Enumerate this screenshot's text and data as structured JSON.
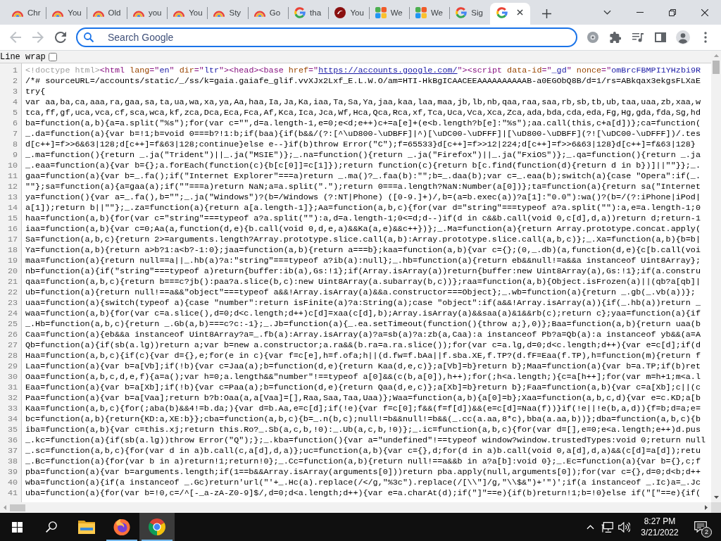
{
  "tabs": [
    {
      "title": "Chr",
      "kind": "arc",
      "selected": false
    },
    {
      "title": "You",
      "kind": "arc",
      "selected": false
    },
    {
      "title": "Old",
      "kind": "arc",
      "selected": false
    },
    {
      "title": "you",
      "kind": "arc",
      "selected": false
    },
    {
      "title": "You",
      "kind": "arc",
      "selected": false
    },
    {
      "title": "Sty",
      "kind": "arc",
      "selected": false
    },
    {
      "title": "Go",
      "kind": "arc",
      "selected": false
    },
    {
      "title": "tha",
      "kind": "google",
      "selected": false
    },
    {
      "title": "You",
      "kind": "disc",
      "selected": false
    },
    {
      "title": "We",
      "kind": "tiles",
      "selected": false
    },
    {
      "title": "We",
      "kind": "tiles",
      "selected": false
    },
    {
      "title": "Sig",
      "kind": "google",
      "selected": false
    },
    {
      "kind": "google",
      "selected": true
    }
  ],
  "toolbar": {
    "nav": [
      {
        "kind": "back",
        "disabled": true
      },
      {
        "kind": "forward",
        "disabled": true
      },
      {
        "kind": "reload",
        "disabled": false
      }
    ],
    "omnibox": {
      "placeholder": "Search Google"
    }
  },
  "viewer": {
    "line_wrap": {
      "label": "Line wrap",
      "checked": false
    },
    "lines": [
      {
        "number": "1",
        "segments": [
          {
            "kind": "doctype",
            "text": "<!doctype html>"
          },
          {
            "kind": "tag",
            "text": "<html "
          },
          {
            "kind": "attr",
            "text": "lang"
          },
          {
            "kind": "tag",
            "text": "=\""
          },
          {
            "kind": "value",
            "text": "en"
          },
          {
            "kind": "tag",
            "text": "\" "
          },
          {
            "kind": "attr",
            "text": "dir"
          },
          {
            "kind": "tag",
            "text": "=\""
          },
          {
            "kind": "value",
            "text": "ltr"
          },
          {
            "kind": "tag",
            "text": "\">"
          },
          {
            "kind": "tag",
            "text": "<head>"
          },
          {
            "kind": "tag",
            "text": "<base "
          },
          {
            "kind": "attr",
            "text": "href"
          },
          {
            "kind": "tag",
            "text": "=\""
          },
          {
            "kind": "link",
            "text": "https://accounts.google.com/"
          },
          {
            "kind": "tag",
            "text": "\">"
          },
          {
            "kind": "tag",
            "text": "<script "
          },
          {
            "kind": "attr",
            "text": "data-id"
          },
          {
            "kind": "tag",
            "text": "=\""
          },
          {
            "kind": "value",
            "text": "_gd"
          },
          {
            "kind": "tag",
            "text": "\" "
          },
          {
            "kind": "attr",
            "text": "nonce"
          },
          {
            "kind": "tag",
            "text": "=\""
          },
          {
            "kind": "value",
            "text": "omBrcFBMPI1YHzbi9R"
          }
        ]
      },
      {
        "number": "2",
        "text": "/*# sourceURL=/accounts/static/_/ss/k=gaia.gaiafe_glif.vvXJx2Lxf_E.L.W.O/am=HTI-HkBgICAACEEAAAAAAAAAAB-a0EGObQ8B/d=1/rs=ABkqax3ekgsFLXaE"
      },
      {
        "number": "3",
        "text": "try{"
      },
      {
        "number": "4",
        "text": "var aa,ba,ca,aaa,ra,gaa,sa,ta,ua,wa,xa,ya,Aa,haa,Ia,Ja,Ka,iaa,Ta,Sa,Ya,jaa,kaa,laa,maa,jb,lb,nb,qaa,raa,saa,rb,sb,tb,ub,taa,uaa,zb,xaa,w"
      },
      {
        "number": "5",
        "text": "tca,ff,gf,uca,vca,cf,sca,wca,kf,zca,Dca,Eca,Fca,Af,Kca,Ica,Jca,Wf,Hca,Qca,Rca,xf,Tca,Uca,Vca,Xca,Zca,ada,bda,cda,eda,Fg,Hg,gda,fda,Sg,hd"
      },
      {
        "number": "6",
        "text": "ba=function(a,b){a=a.split(\"%s\");for(var c=\"\",d=a.length-1,e=0;e<d;e++)c+=a[e]+(e<b.length?b[e]:\"%s\");aa.call(this,c+a[d])};ca=function("
      },
      {
        "number": "7",
        "text": "_.da=function(a){var b=!1;b=void 0===b?!1:b;if(baa){if(b&&/(?:[^\\uD800-\\uDBFF]|^)[\\uDC00-\\uDFFF]|[\\uD800-\\uDBFF](?![\\uDC00-\\uDFFF])/.tes"
      },
      {
        "number": "8",
        "text": "d[c++]=f>>6&63|128;d[c++]=f&63|128;continue}else e--}if(b)throw Error(\"C\");f=65533}d[c++]=f>>12|224;d[c++]=f>>6&63|128}d[c++]=f&63|128}"
      },
      {
        "number": "9",
        "text": "_.ma=function(){return _.ja(\"Trident\")||_.ja(\"MSIE\")};_.na=function(){return _.ja(\"Firefox\")||_.ja(\"FxiOS\")};_.qa=function(){return _.ja"
      },
      {
        "number": "10",
        "text": "_.eaa=function(a){var b={};a.forEach(function(c){b[c[0]]=c[1]});return function(c){return b[c.find(function(d){return d in b})]||\"\"}};_."
      },
      {
        "number": "11",
        "text": "gaa=function(a){var b=_.fa();if(\"Internet Explorer\"===a)return _.ma()?_.faa(b):\"\";b=_.daa(b);var c=_.eaa(b);switch(a){case \"Opera\":if(_."
      },
      {
        "number": "12",
        "text": "\"\"};sa=function(a){a=gaa(a);if(\"\"===a)return NaN;a=a.split(\".\");return 0===a.length?NaN:Number(a[0])};ta=function(a){return sa(\"Internet"
      },
      {
        "number": "13",
        "text": "ya=function(){var a=_.fa(),b=\"\";_.ja(\"Windows\")?(b=/Windows (?:NT|Phone) ([0-9.]+)/,b=(a=b.exec(a))?a[1]:\"0.0\"):wa()?(b=/(?:iPhone|iPod|"
      },
      {
        "number": "14",
        "text": "a[1]);return b||\"\"};_.za=function(a){return a[a.length-1]};Aa=function(a,b,c){for(var d=\"string\"===typeof a?a.split(\"\"):a,e=a.length-1;0"
      },
      {
        "number": "15",
        "text": "haa=function(a,b){for(var c=\"string\"===typeof a?a.split(\"\"):a,d=a.length-1;0<=d;d--)if(d in c&&b.call(void 0,c[d],d,a))return d;return-1"
      },
      {
        "number": "16",
        "text": "iaa=function(a,b){var c=0;Aa(a,function(d,e){b.call(void 0,d,e,a)&&Ka(a,e)&&c++})};_.Ma=function(a){return Array.prototype.concat.apply("
      },
      {
        "number": "17",
        "text": "Sa=function(a,b,c){return 2>=arguments.length?Array.prototype.slice.call(a,b):Array.prototype.slice.call(a,b,c)};_.Xa=function(a,b){b=b|"
      },
      {
        "number": "18",
        "text": "Ya=function(a,b){return a>b?1:a<b?-1:0};jaa=function(a,b){return a===b};kaa=function(a,b){var c={};(0,_.db)(a,function(d,e){c[b.call(voi"
      },
      {
        "number": "19",
        "text": "maa=function(a){return null==a||_.hb(a)?a:\"string\"===typeof a?ib(a):null};_.hb=function(a){return eb&&null!=a&&a instanceof Uint8Array};"
      },
      {
        "number": "20",
        "text": "nb=function(a){if(\"string\"===typeof a)return{buffer:ib(a),Gs:!1};if(Array.isArray(a))return{buffer:new Uint8Array(a),Gs:!1};if(a.constru"
      },
      {
        "number": "21",
        "text": "qaa=function(a,b,c){return b===c?jb():paa?a.slice(b,c):new Uint8Array(a.subarray(b,c))};raa=function(a,b){Object.isFrozen(a)||(qb?a[qb]|"
      },
      {
        "number": "22",
        "text": "ub=function(a){return null!==a&&\"object\"===typeof a&&!Array.isArray(a)&&a.constructor===Object};_.wb=function(a){return _.gb(_.vb(a))};"
      },
      {
        "number": "23",
        "text": "uaa=function(a){switch(typeof a){case \"number\":return isFinite(a)?a:String(a);case \"object\":if(a&&!Array.isArray(a)){if(_.hb(a))return _"
      },
      {
        "number": "24",
        "text": "waa=function(a,b){for(var c=a.slice(),d=0;d<c.length;d++)c[d]=xaa(c[d],b);Array.isArray(a)&&saa(a)&1&&rb(c);return c};yaa=function(a){if"
      },
      {
        "number": "25",
        "text": "_.Hb=function(a,b,c){return _.Gb(a,b)===c?c:-1};_.Jb=function(a){_.ea.setTimeout(function(){throw a;},0)};Baa=function(a,b){return uaa(b"
      },
      {
        "number": "26",
        "text": "Caa=function(a){eb&&a instanceof Uint8Array?a=_.fb(a):Array.isArray(a)?a=sb(a)?a:zb(a,Caa):a instanceof Pb?a=Qb(a):a instanceof yb&&(a=A"
      },
      {
        "number": "27",
        "text": "Qb=function(a){if(sb(a.lg))return a;var b=new a.constructor;a.ra&&(b.ra=a.ra.slice());for(var c=a.lg,d=0;d<c.length;d++){var e=c[d];if(d"
      },
      {
        "number": "28",
        "text": "Haa=function(a,b,c){if(c){var d={},e;for(e in c){var f=c[e],h=f.ofa;h||(d.fw=f.bAa||f.sba.XE,f.TP?(d.fF=Eaa(f.TP),h=function(m){return f"
      },
      {
        "number": "29",
        "text": "Laa=function(a){var b=a[Vb];if(!b){var c=Jaa(a);b=function(d,e){return Kaa(d,e,c)};a[Vb]=b}return b};Maa=function(a){var b=a.TP;if(b)ret"
      },
      {
        "number": "30",
        "text": "Oaa=function(a,b,c,d,e,f){a=a();var h=0;a.length&&\"number\"!==typeof a[0]&&(c(b,a[0]),h++);for(;h<a.length;){c=a[h++];for(var m=h+1;m<a.l"
      },
      {
        "number": "31",
        "text": "Eaa=function(a){var b=a[Xb];if(!b){var c=Paa(a);b=function(d,e){return Qaa(d,e,c)};a[Xb]=b}return b};Faa=function(a,b){var c=a[Xb];c||(c"
      },
      {
        "number": "32",
        "text": "Paa=function(a){var b=a[Vaa];return b?b:Oaa(a,a[Vaa]=[],Raa,Saa,Taa,Uaa)};Waa=function(a,b){a[0]=b};Xaa=function(a,b,c,d){var e=c.KD;a[b"
      },
      {
        "number": "33",
        "text": "Kaa=function(a,b,c){for(;aba(b)&&4!=b.da;){var d=b.Aa,e=c[d];if(!e){var f=c[0];f&&(f=f[d])&&(e=c[d]=Naa(f))}if(!e||!e(b,a,d)){f=b;d=a;e="
      },
      {
        "number": "34",
        "text": "bc=function(a,b){return{KD:a,XE:b}};cba=function(a,b,c){b=_.n(b,c);null!=b&&null!=b&&(_.cc(a.aa,8*c),bba(a.aa,b))};dba=function(a,b,c){b"
      },
      {
        "number": "35",
        "text": "iba=function(a,b){var c=this.xj;return this.Ro?_.Sb(a,c,b,!0):_.Ub(a,c,b,!0)};_.ic=function(a,b,c){for(var d=[],e=0;e<a.length;e++)d.pus"
      },
      {
        "number": "36",
        "text": "_.kc=function(a){if(sb(a.lg))throw Error(\"Q\");};_.kba=function(){var a=\"undefined\"!==typeof window?window.trustedTypes:void 0;return null"
      },
      {
        "number": "37",
        "text": "_.sc=function(a,b,c){for(var d in a)b.call(c,a[d],d,a)};uc=function(a,b){var c={},d;for(d in a)b.call(void 0,a[d],d,a)&&(c[d]=a[d]);retu"
      },
      {
        "number": "38",
        "text": "_.Bc=function(a){for(var b in a)return!1;return!0};_.Cc=function(a,b){return null!==a&&b in a?a[b]:void 0};_.Ec=function(a){var b={},c;f"
      },
      {
        "number": "39",
        "text": "pba=function(a){var b=arguments.length;if(1==b&&Array.isArray(arguments[0]))return pba.apply(null,arguments[0]);for(var c={},d=0;d<b;d++"
      },
      {
        "number": "40",
        "text": "wba=function(a){if(a instanceof _.Gc)return'url(\"'+_.Hc(a).replace(/</g,\"%3c\").replace(/[\\\\\"]/g,\"\\\\$&\")+'\")';if(a instanceof _.Ic)a=_.Jc"
      },
      {
        "number": "41",
        "text": "uba=function(a){for(var b=!0,c=/^[-_a-zA-Z0-9]$/,d=0;d<a.length;d++){var e=a.charAt(d);if(\"]\"==e){if(b)return!1;b=!0}else if(\"[\"==e){if("
      }
    ]
  },
  "taskbar": {
    "apps": [
      {
        "kind": "folder",
        "running": false,
        "selected": false
      },
      {
        "kind": "flame",
        "running": true,
        "selected": false
      },
      {
        "kind": "orb",
        "running": true,
        "selected": true
      }
    ],
    "clock": {
      "time": "8:27 PM",
      "date": "3/21/2022"
    },
    "notifications": "2"
  }
}
